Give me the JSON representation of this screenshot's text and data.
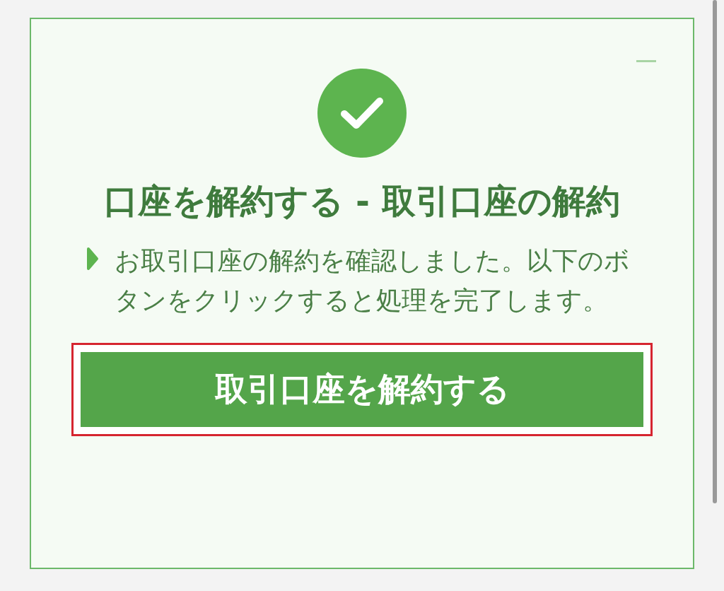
{
  "dialog": {
    "title": "口座を解約する - 取引口座の解約",
    "message": "お取引口座の解約を確認しました。以下のボタンをクリックすると処理を完了します。",
    "button": {
      "label": "取引口座を解約する",
      "highlighted": true
    }
  }
}
